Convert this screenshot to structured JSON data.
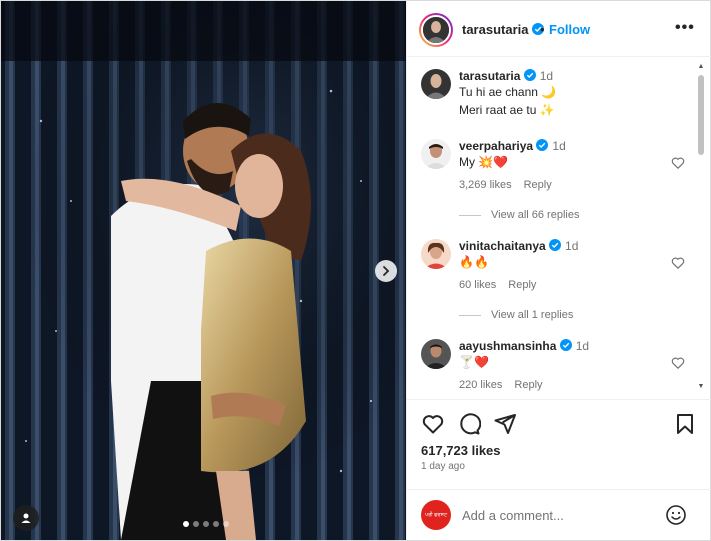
{
  "post": {
    "author": "tarasutaria",
    "follow_label": "Follow",
    "separator": "•",
    "more_label": "•••",
    "likes": "617,723 likes",
    "age": "1 day ago",
    "carousel": {
      "total": 5,
      "active": 1
    }
  },
  "caption": {
    "user": "tarasutaria",
    "time": "1d",
    "line1": "Tu hi ae chann 🌙",
    "line2": "Meri raat ae tu ✨"
  },
  "comments": [
    {
      "user": "veerpahariya",
      "time": "1d",
      "text": "My 💥❤️",
      "likes": "3,269 likes",
      "reply": "Reply",
      "view_replies": "View all 66 replies"
    },
    {
      "user": "vinitachaitanya",
      "time": "1d",
      "text": "🔥🔥",
      "likes": "60 likes",
      "reply": "Reply",
      "view_replies": "View all 1 replies"
    },
    {
      "user": "aayushmansinha",
      "time": "1d",
      "text": "🍸❤️",
      "likes": "220 likes",
      "reply": "Reply"
    }
  ],
  "composer": {
    "placeholder": "Add a comment...",
    "avatar_text": "ਪਰੀ ਫਰਸਟ"
  },
  "colors": {
    "accent": "#0095f6",
    "verified": "#0095f6",
    "muted": "#737373"
  }
}
